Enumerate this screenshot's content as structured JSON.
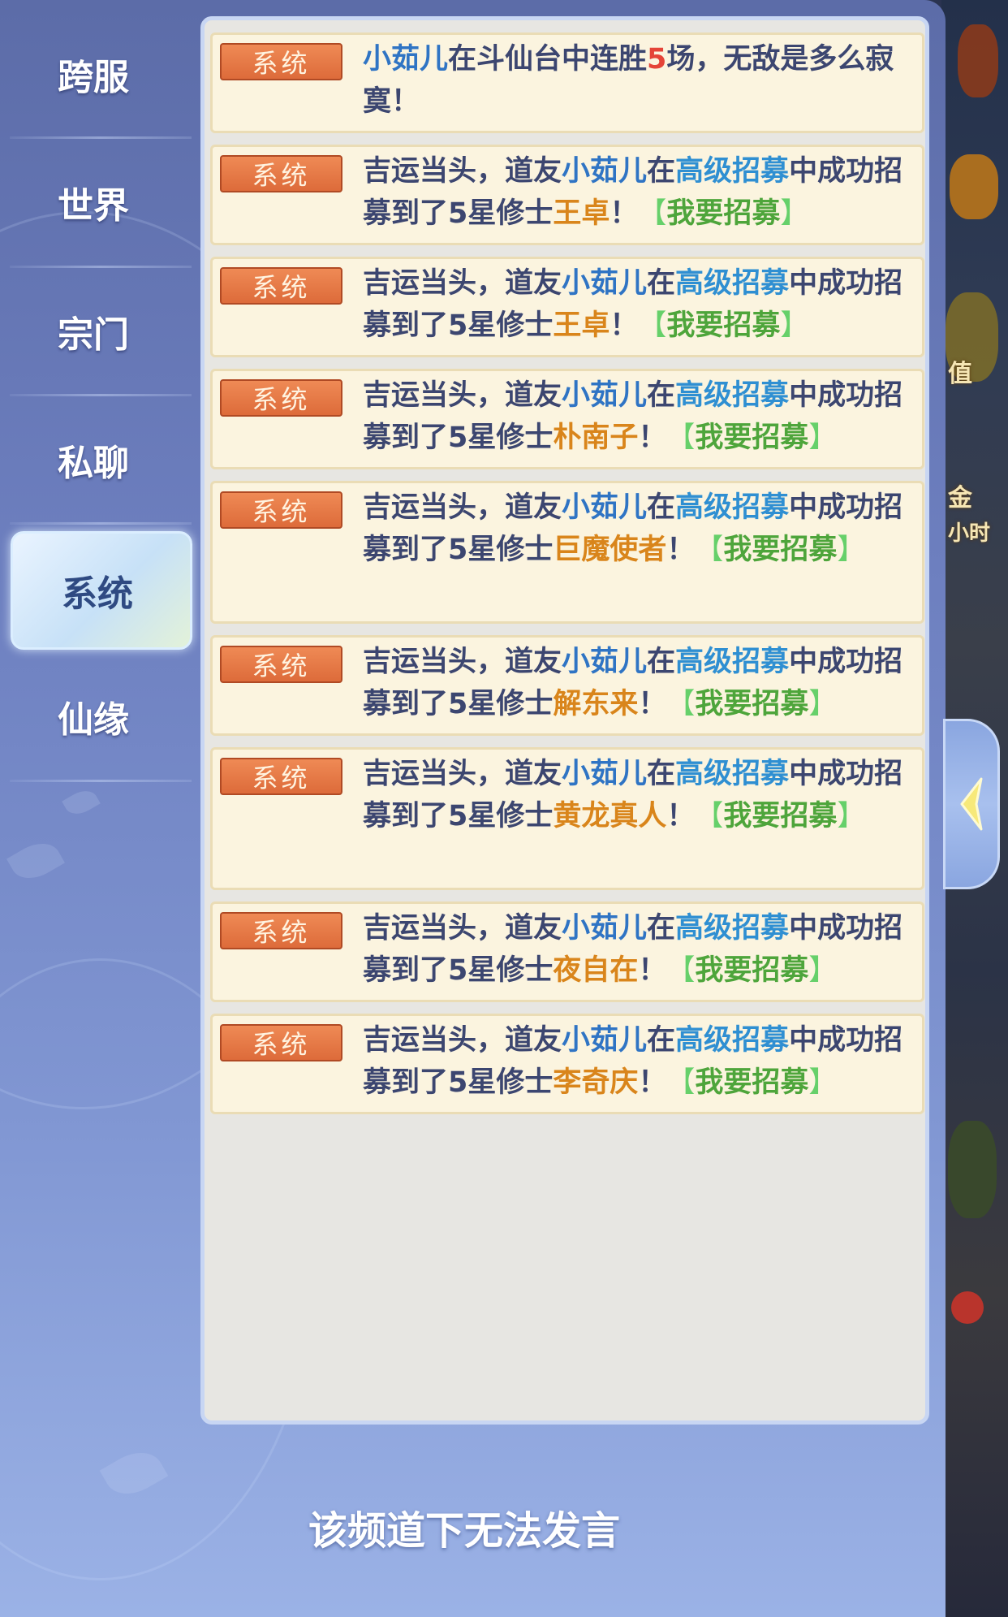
{
  "tabs": [
    "跨服",
    "世界",
    "宗门",
    "私聊",
    "系统",
    "仙缘"
  ],
  "active_tab": "系统",
  "messages": [
    {
      "tag": "系统",
      "parts": [
        [
          "小茹儿",
          "name"
        ],
        [
          "在斗仙台中连胜",
          ""
        ],
        [
          "5",
          "wins"
        ],
        [
          "场，无敌是多么寂寞！",
          ""
        ]
      ]
    },
    {
      "tag": "系统",
      "parts": [
        [
          "吉运当头，道友",
          ""
        ],
        [
          "小茹儿",
          "name"
        ],
        [
          "在",
          ""
        ],
        [
          "高级招募",
          "mode"
        ],
        [
          "中成功招募到了5星修士",
          ""
        ],
        [
          "王卓",
          "hero"
        ],
        [
          "！",
          ""
        ],
        [
          "【",
          "bracket"
        ],
        [
          "我要招募",
          "link"
        ],
        [
          "】",
          "bracket"
        ]
      ]
    },
    {
      "tag": "系统",
      "parts": [
        [
          "吉运当头，道友",
          ""
        ],
        [
          "小茹儿",
          "name"
        ],
        [
          "在",
          ""
        ],
        [
          "高级招募",
          "mode"
        ],
        [
          "中成功招募到了5星修士",
          ""
        ],
        [
          "王卓",
          "hero"
        ],
        [
          "！",
          ""
        ],
        [
          "【",
          "bracket"
        ],
        [
          "我要招募",
          "link"
        ],
        [
          "】",
          "bracket"
        ]
      ]
    },
    {
      "tag": "系统",
      "parts": [
        [
          "吉运当头，道友",
          ""
        ],
        [
          "小茹儿",
          "name"
        ],
        [
          "在",
          ""
        ],
        [
          "高级招募",
          "mode"
        ],
        [
          "中成功招募到了5星修士",
          ""
        ],
        [
          "朴南子",
          "hero"
        ],
        [
          "！",
          ""
        ],
        [
          "【",
          "bracket"
        ],
        [
          "我要招募",
          "link"
        ],
        [
          "】",
          "bracket"
        ]
      ]
    },
    {
      "tag": "系统",
      "parts": [
        [
          "吉运当头，道友",
          ""
        ],
        [
          "小茹儿",
          "name"
        ],
        [
          "在",
          ""
        ],
        [
          "高级招募",
          "mode"
        ],
        [
          "中成功招募到了5星修士",
          ""
        ],
        [
          "巨魔使者",
          "hero"
        ],
        [
          "！",
          ""
        ],
        [
          "【",
          "bracket"
        ],
        [
          "我要招募",
          "link"
        ],
        [
          "】",
          "bracket"
        ]
      ]
    },
    {
      "tag": "系统",
      "parts": [
        [
          "吉运当头，道友",
          ""
        ],
        [
          "小茹儿",
          "name"
        ],
        [
          "在",
          ""
        ],
        [
          "高级招募",
          "mode"
        ],
        [
          "中成功招募到了5星修士",
          ""
        ],
        [
          "解东来",
          "hero"
        ],
        [
          "！",
          ""
        ],
        [
          "【",
          "bracket"
        ],
        [
          "我要招募",
          "link"
        ],
        [
          "】",
          "bracket"
        ]
      ]
    },
    {
      "tag": "系统",
      "parts": [
        [
          "吉运当头，道友",
          ""
        ],
        [
          "小茹儿",
          "name"
        ],
        [
          "在",
          ""
        ],
        [
          "高级招募",
          "mode"
        ],
        [
          "中成功招募到了5星修士",
          ""
        ],
        [
          "黄龙真人",
          "hero"
        ],
        [
          "！",
          ""
        ],
        [
          "【",
          "bracket"
        ],
        [
          "我要招募",
          "link"
        ],
        [
          "】",
          "bracket"
        ]
      ]
    },
    {
      "tag": "系统",
      "parts": [
        [
          "吉运当头，道友",
          ""
        ],
        [
          "小茹儿",
          "name"
        ],
        [
          "在",
          ""
        ],
        [
          "高级招募",
          "mode"
        ],
        [
          "中成功招募到了5星修士",
          ""
        ],
        [
          "夜自在",
          "hero"
        ],
        [
          "！",
          ""
        ],
        [
          "【",
          "bracket"
        ],
        [
          "我要招募",
          "link"
        ],
        [
          "】",
          "bracket"
        ]
      ]
    },
    {
      "tag": "系统",
      "parts": [
        [
          "吉运当头，道友",
          ""
        ],
        [
          "小茹儿",
          "name"
        ],
        [
          "在",
          ""
        ],
        [
          "高级招募",
          "mode"
        ],
        [
          "中成功招募到了5星修士",
          ""
        ],
        [
          "李奇庆",
          "hero"
        ],
        [
          "！",
          ""
        ],
        [
          "【",
          "bracket"
        ],
        [
          "我要招募",
          "link"
        ],
        [
          "】",
          "bracket"
        ]
      ]
    }
  ],
  "footer": "该频道下无法发言",
  "scene_labels": [
    "值",
    "金",
    "小时"
  ],
  "colors": {
    "name": "#2f74c4",
    "wins": "#e54438",
    "mode": "#2f8fd2",
    "hero": "#d9851b",
    "link": "#4ea53b",
    "badge": "#dd6b3a",
    "text": "#3c4670"
  }
}
